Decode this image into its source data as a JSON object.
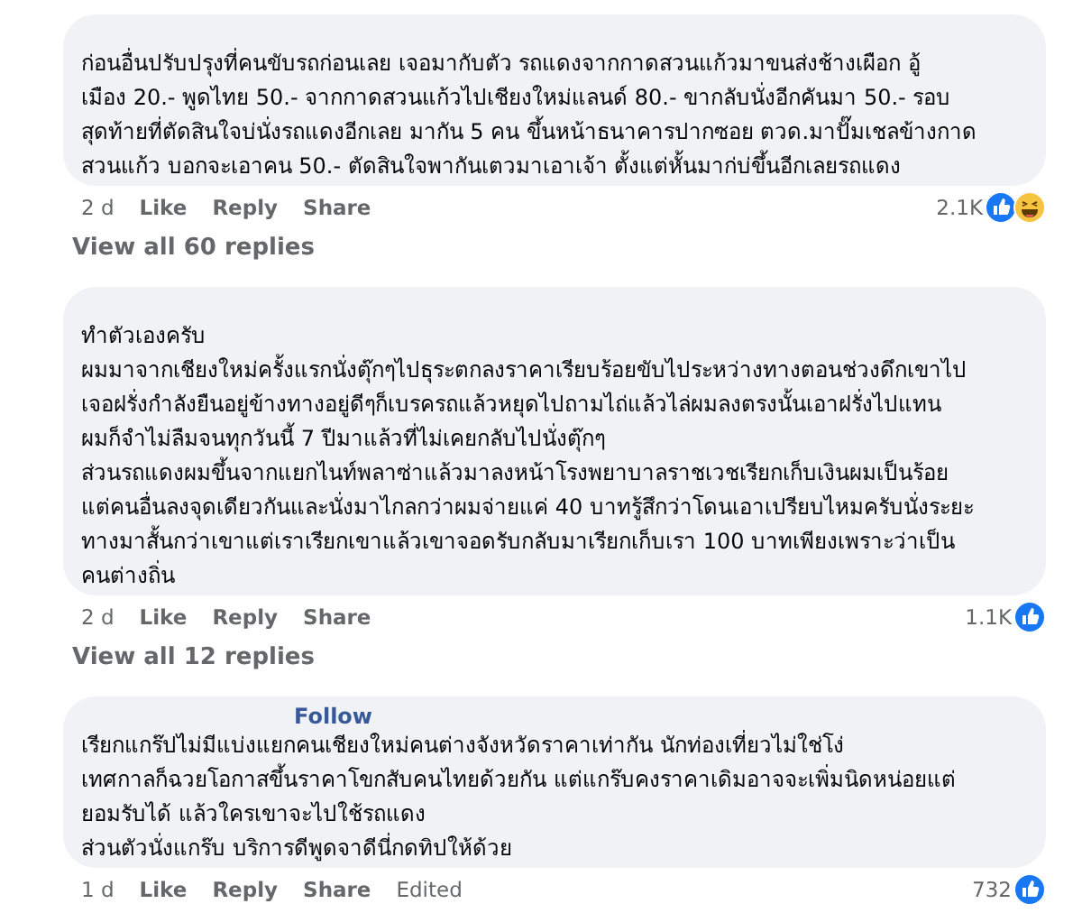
{
  "comments": [
    {
      "lines": [
        "ก่อนอื่นปรับปรุงที่คนขับรถก่อนเลย เจอมากับตัว รถแดงจากกาดสวนแก้วมาขนส่งช้างเผือก อู้",
        "เมือง 20.- พูดไทย 50.- จากกาดสวนแก้วไปเชียงใหม่แลนด์ 80.- ขากลับนั่งอีกคันมา 50.- รอบ",
        "สุดท้ายที่ตัดสินใจบ่นั่งรถแดงอีกเลย มากัน 5 คน ขึ้นหน้าธนาคารปากซอย ตวด.มาปั๊มเชลข้างกาด",
        "สวนแก้ว บอกจะเอาคน 50.- ตัดสินใจพากันเตวมาเอาเจ้า ตั้งแต่หั้นมาก่บ่ขึ้นอีกเลยรถแดง"
      ],
      "time": "2 d",
      "actions": [
        "Like",
        "Reply",
        "Share"
      ],
      "count": "2.1K",
      "reactions": [
        {
          "kind": "like"
        },
        {
          "kind": "haha"
        }
      ],
      "replies_link": "View all 60 replies"
    },
    {
      "lines": [
        "ทำตัวเองครับ",
        "ผมมาจากเชียงใหม่ครั้งแรกนั่งตุ๊กๆไปธุระตกลงราคาเรียบร้อยขับไประหว่างทางตอนช่วงดึกเขาไป",
        "เจอฝรั่งกำลังยืนอยู่ข้างทางอยู่ดีๆก็เบรครถแล้วหยุดไปถามไถ่แล้วไล่ผมลงตรงนั้นเอาฝรั่งไปแทน",
        "ผมก็จำไม่ลืมจนทุกวันนี้ 7 ปีมาแล้วที่ไม่เคยกลับไปนั่งตุ๊กๆ",
        "ส่วนรถแดงผมขึ้นจากแยกไนท์พลาซ่าแล้วมาลงหน้าโรงพยาบาลราชเวชเรียกเก็บเงินผมเป็นร้อย",
        "แต่คนอื่นลงจุดเดียวกันและนั่งมาไกลกว่าผมจ่ายแค่ 40 บาทรู้สึกว่าโดนเอาเปรียบไหมครับนั่งระยะ",
        "ทางมาสั้นกว่าเขาแต่เราเรียกเขาแล้วเขาจอดรับกลับมาเรียกเก็บเรา 100 บาทเพียงเพราะว่าเป็น",
        "คนต่างถิ่น"
      ],
      "time": "2 d",
      "actions": [
        "Like",
        "Reply",
        "Share"
      ],
      "count": "1.1K",
      "reactions": [
        {
          "kind": "like"
        }
      ],
      "replies_link": "View all 12 replies"
    },
    {
      "follow": "Follow",
      "lines": [
        "เรียกแกร๊ปไม่มีแบ่งแยกคนเชียงใหม่คนต่างจังหวัดราคาเท่ากัน นักท่องเที่ยวไม่ใช่โง่",
        "เทศกาลก็ฉวยโอกาสขึ้นราคาโขกสับคนไทยด้วยกัน แต่แกร๊บคงราคาเดิมอาจจะเพิ่มนิดหน่อยแต่",
        "ยอมรับได้ แล้วใครเขาจะไปใช้รถแดง",
        "ส่วนตัวนั่งแกร๊บ บริการดีพูดจาดีนี่กดทิปให้ด้วย"
      ],
      "time": "1 d",
      "actions": [
        "Like",
        "Reply",
        "Share"
      ],
      "edited": "Edited",
      "count": "732",
      "reactions": [
        {
          "kind": "like"
        }
      ]
    }
  ]
}
